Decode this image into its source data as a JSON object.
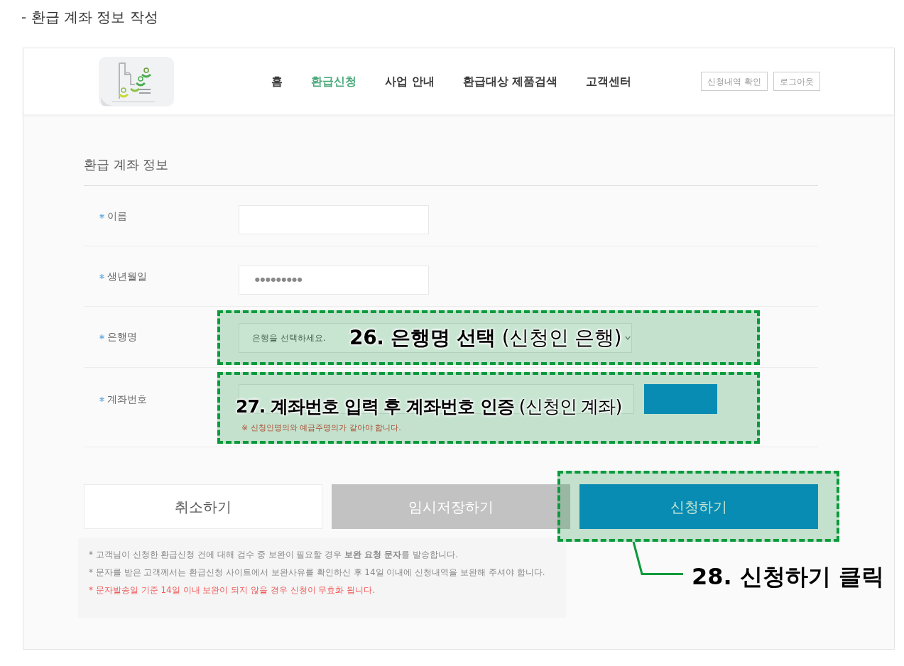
{
  "page_heading": "- 환급 계좌 정보 작성",
  "header": {
    "nav": [
      {
        "label": "홈",
        "selected": false
      },
      {
        "label": "환급신청",
        "selected": true
      },
      {
        "label": "사업 안내",
        "selected": false
      },
      {
        "label": "환급대상 제품검색",
        "selected": false
      },
      {
        "label": "고객센터",
        "selected": false
      }
    ],
    "buttons": [
      "신청내역 확인",
      "로그아웃"
    ]
  },
  "form": {
    "title": "환급 계좌 정보",
    "fields": [
      {
        "kind": "text",
        "label": "이름",
        "required": true
      },
      {
        "kind": "password",
        "label": "생년월일",
        "required": true,
        "value": "●●●●●●●●●"
      },
      {
        "kind": "select",
        "label": "은행명",
        "required": true,
        "placeholder": "은행을 선택하세요.",
        "annotation": "**26. 은행명 선택** (신청인 은행)"
      },
      {
        "kind": "account",
        "label": "계좌번호",
        "required": true,
        "note": "※ 신청인명의와 예금주명의가 같아야 합니다.",
        "annotation": "**27. 계좌번호 입력 후 계좌번호 인증** (신청인 계좌)"
      }
    ]
  },
  "actions": [
    {
      "kind": "cancel",
      "label": "취소하기"
    },
    {
      "kind": "save",
      "label": "임시저장하기"
    },
    {
      "kind": "submit",
      "label": "신청하기",
      "annotation": "28. 신청하기 클릭"
    }
  ],
  "notices": [
    {
      "kind": "info",
      "text": "* 고객님이 신청한 환급신청 건에 대해 검수 중 보완이 필요할 경우 **보완 요청 문자**를 발송합니다."
    },
    {
      "kind": "info",
      "text": "* 문자를 받은 고객께서는 환급신청 사이트에서 보완사유를 확인하신 후 14일 이내에 신청내역을 보완해 주셔야 합니다."
    },
    {
      "kind": "warning",
      "text": "* 문자발송일 기준 14일 이내 보완이 되지 않을 경우 신청이 무효화 됩니다."
    }
  ]
}
